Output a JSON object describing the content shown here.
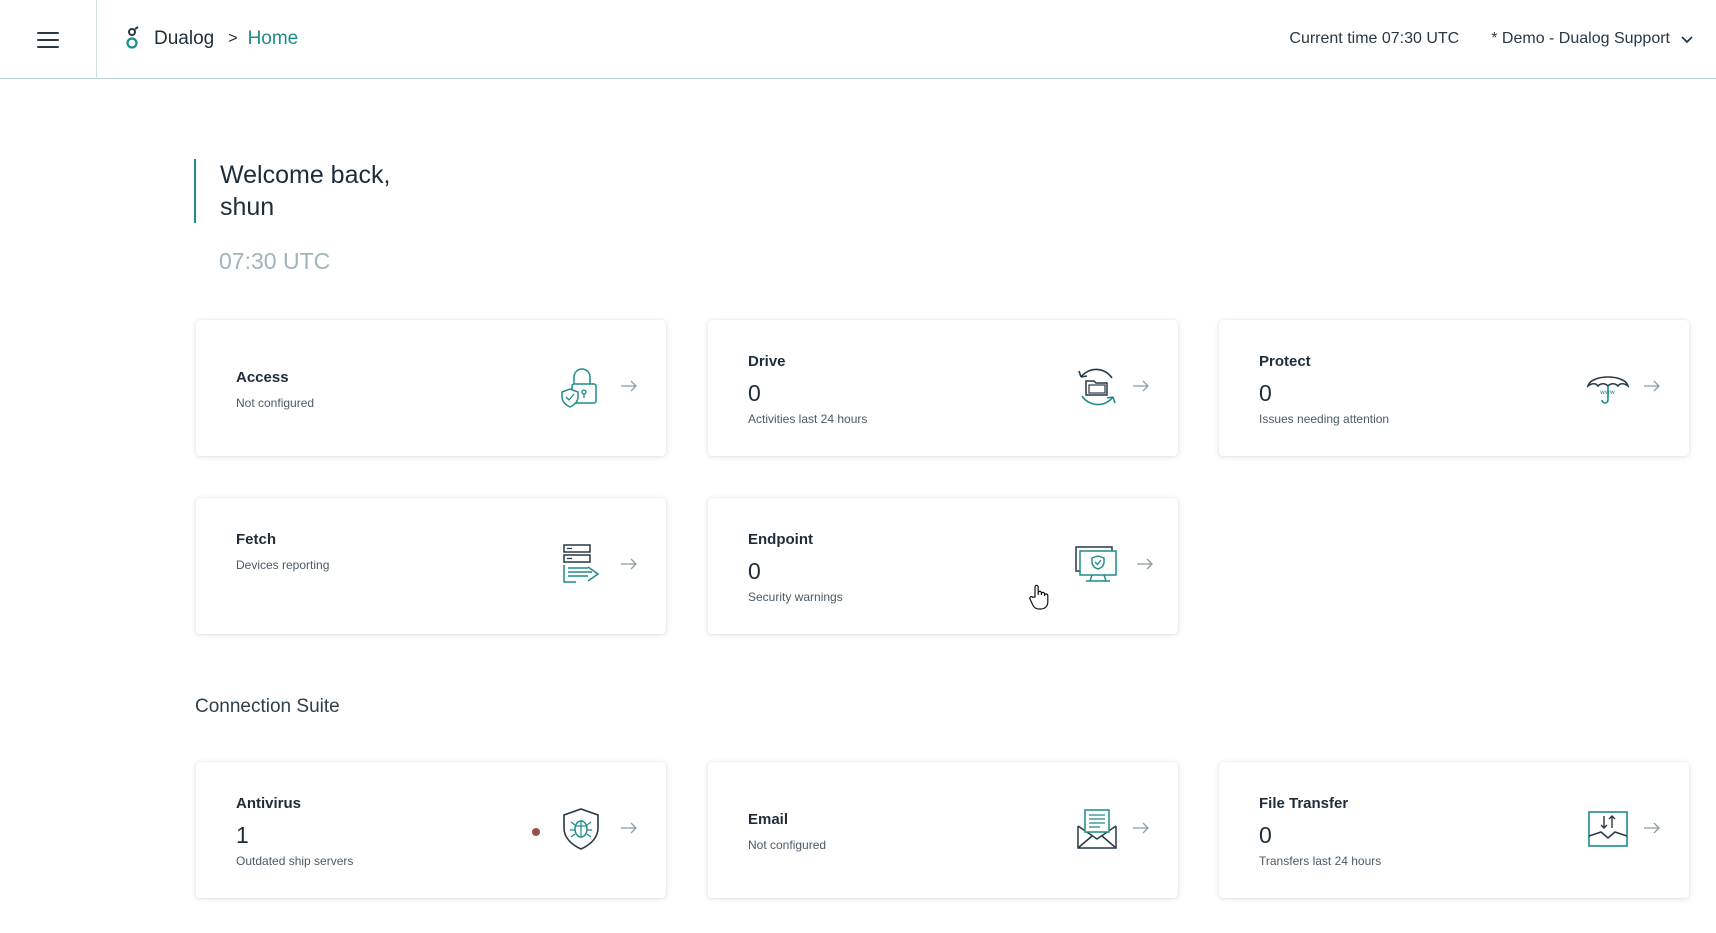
{
  "topbar": {
    "brand": "Dualog",
    "separator": ">",
    "breadcrumb": "Home",
    "current_time": "Current time 07:30 UTC",
    "account": "* Demo - Dualog Support"
  },
  "welcome": {
    "line1": "Welcome back,",
    "line2": "shun",
    "clock": "07:30 UTC"
  },
  "cards": {
    "access": {
      "title": "Access",
      "sub": "Not configured"
    },
    "drive": {
      "title": "Drive",
      "value": "0",
      "sub": "Activities last 24 hours"
    },
    "protect": {
      "title": "Protect",
      "value": "0",
      "sub": "Issues needing attention"
    },
    "fetch": {
      "title": "Fetch",
      "sub": "Devices reporting"
    },
    "endpoint": {
      "title": "Endpoint",
      "value": "0",
      "sub": "Security warnings"
    }
  },
  "connection_suite": {
    "title": "Connection Suite",
    "antivirus": {
      "title": "Antivirus",
      "value": "1",
      "sub": "Outdated ship servers"
    },
    "email": {
      "title": "Email",
      "sub": "Not configured"
    },
    "file_transfer": {
      "title": "File Transfer",
      "value": "0",
      "sub": "Transfers last 24 hours"
    }
  },
  "colors": {
    "accent": "#1f8c8a",
    "text": "#1f2d3a",
    "muted": "#9fb4bb",
    "alert_dot": "#9b5050"
  },
  "icons": [
    "menu-icon",
    "dualog-logo-icon",
    "chevron-down-icon",
    "lock-shield-icon",
    "folder-sync-icon",
    "umbrella-icon",
    "server-transfer-icon",
    "monitor-shield-icon",
    "bug-shield-icon",
    "mail-document-icon",
    "inbox-transfer-icon",
    "arrow-right-icon"
  ]
}
